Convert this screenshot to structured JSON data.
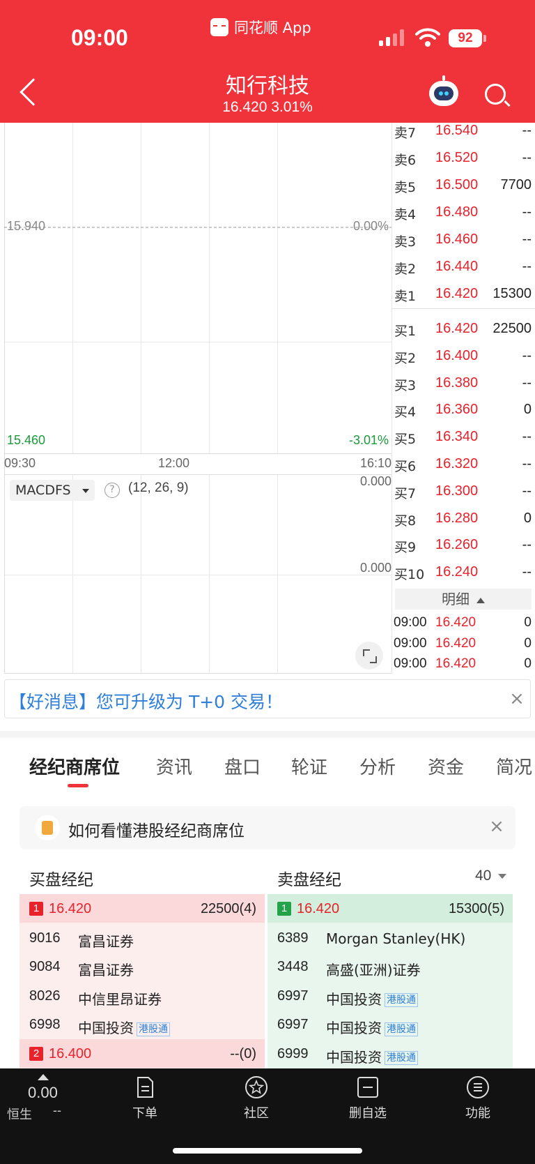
{
  "status_bar": {
    "time": "09:00",
    "app_label": "同花顺 App",
    "battery": "92"
  },
  "header": {
    "title": "知行科技",
    "price_line": "16.420 3.01%"
  },
  "chart": {
    "ref_price": "15.940",
    "ref_pct": "0.00%",
    "low_price": "15.460",
    "low_pct": "-3.01%",
    "time_start": "09:30",
    "time_mid": "12:00",
    "time_end": "16:10",
    "macd_upper": "0.000",
    "macd_lower": "0.000",
    "indicator_name": "MACDFS",
    "indicator_help": "?",
    "indicator_params": "(12, 26, 9)"
  },
  "orderbook": {
    "asks": [
      {
        "label": "卖7",
        "price": "16.540",
        "volume": "--"
      },
      {
        "label": "卖6",
        "price": "16.520",
        "volume": "--"
      },
      {
        "label": "卖5",
        "price": "16.500",
        "volume": "7700"
      },
      {
        "label": "卖4",
        "price": "16.480",
        "volume": "--"
      },
      {
        "label": "卖3",
        "price": "16.460",
        "volume": "--"
      },
      {
        "label": "卖2",
        "price": "16.440",
        "volume": "--"
      },
      {
        "label": "卖1",
        "price": "16.420",
        "volume": "15300"
      }
    ],
    "bids": [
      {
        "label": "买1",
        "price": "16.420",
        "volume": "22500"
      },
      {
        "label": "买2",
        "price": "16.400",
        "volume": "--"
      },
      {
        "label": "买3",
        "price": "16.380",
        "volume": "--"
      },
      {
        "label": "买4",
        "price": "16.360",
        "volume": "0"
      },
      {
        "label": "买5",
        "price": "16.340",
        "volume": "--"
      },
      {
        "label": "买6",
        "price": "16.320",
        "volume": "--"
      },
      {
        "label": "买7",
        "price": "16.300",
        "volume": "--"
      },
      {
        "label": "买8",
        "price": "16.280",
        "volume": "0"
      },
      {
        "label": "买9",
        "price": "16.260",
        "volume": "--"
      },
      {
        "label": "买10",
        "price": "16.240",
        "volume": "--"
      }
    ],
    "detail_label": "明细",
    "ticks": [
      {
        "time": "09:00",
        "price": "16.420",
        "volume": "0"
      },
      {
        "time": "09:00",
        "price": "16.420",
        "volume": "0"
      },
      {
        "time": "09:00",
        "price": "16.420",
        "volume": "0"
      }
    ]
  },
  "banner": {
    "text": "【好消息】您可升级为 T+0 交易！",
    "close": "×"
  },
  "tabs": [
    "经纪商席位",
    "资讯",
    "盘口",
    "轮证",
    "分析",
    "资金",
    "简况"
  ],
  "tip": {
    "text": "如何看懂港股经纪商席位",
    "close": "×"
  },
  "brokers": {
    "buy_title": "买盘经纪",
    "sell_title": "卖盘经纪",
    "depth": "40",
    "hk_tag": "港股通",
    "buy_levels": [
      {
        "level": "1",
        "price": "16.420",
        "volume": "22500(4)",
        "rows": [
          {
            "code": "9016",
            "name": "富昌证券",
            "hk": false
          },
          {
            "code": "9084",
            "name": "富昌证券",
            "hk": false
          },
          {
            "code": "8026",
            "name": "中信里昂证券",
            "hk": false
          },
          {
            "code": "6998",
            "name": "中国投资",
            "hk": true
          }
        ]
      },
      {
        "level": "2",
        "price": "16.400",
        "volume": "--(0)",
        "rows": []
      }
    ],
    "sell_levels": [
      {
        "level": "1",
        "price": "16.420",
        "volume": "15300(5)",
        "rows": [
          {
            "code": "6389",
            "name": "Morgan Stanley(HK)",
            "hk": false
          },
          {
            "code": "3448",
            "name": "高盛(亚洲)证券",
            "hk": false
          },
          {
            "code": "6997",
            "name": "中国投资",
            "hk": true
          },
          {
            "code": "6997",
            "name": "中国投资",
            "hk": true
          },
          {
            "code": "6999",
            "name": "中国投资",
            "hk": true
          }
        ]
      }
    ]
  },
  "bottom_bar": {
    "index_value": "0.00",
    "index_name": "恒生",
    "index_change": "--",
    "nav": [
      {
        "label": "下单",
        "icon": "order-icon"
      },
      {
        "label": "社区",
        "icon": "community-icon"
      },
      {
        "label": "删自选",
        "icon": "remove-watchlist-icon"
      },
      {
        "label": "功能",
        "icon": "menu-icon"
      }
    ]
  },
  "colors": {
    "brand_red": "#f0323a",
    "up_red": "#e8222b",
    "down_green": "#23a349",
    "link_blue": "#2f7fd8"
  }
}
